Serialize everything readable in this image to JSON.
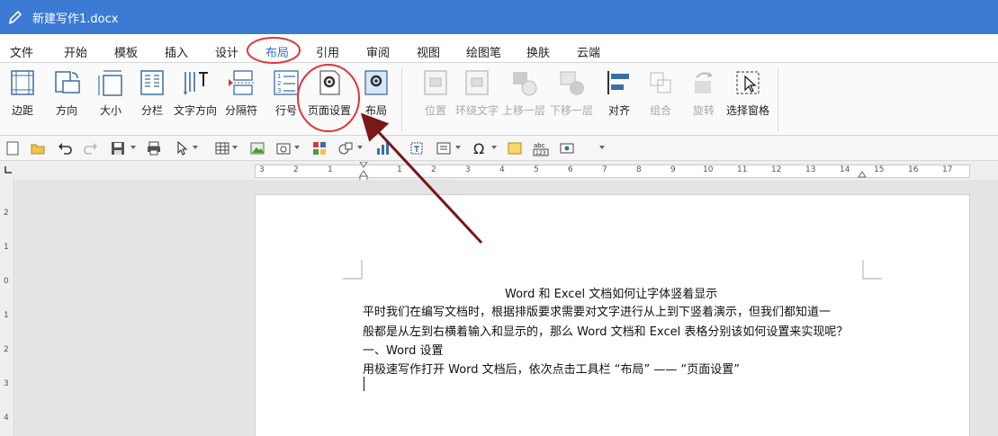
{
  "window": {
    "title": "新建写作1.docx"
  },
  "tabs": [
    {
      "label": "文件"
    },
    {
      "label": "开始"
    },
    {
      "label": "模板"
    },
    {
      "label": "插入"
    },
    {
      "label": "设计"
    },
    {
      "label": "布局"
    },
    {
      "label": "引用"
    },
    {
      "label": "审阅"
    },
    {
      "label": "视图"
    },
    {
      "label": "绘图笔"
    },
    {
      "label": "换肤"
    },
    {
      "label": "云端"
    }
  ],
  "active_tab": "布局",
  "ribbon": {
    "margins": "边距",
    "orientation": "方向",
    "size": "大小",
    "columns": "分栏",
    "text_direction": "文字方向",
    "breaks": "分隔符",
    "line_numbers": "行号",
    "page_setup": "页面设置",
    "layout": "布局",
    "position": "位置",
    "wrap_text": "环绕文字",
    "bring_forward": "上移一层",
    "send_backward": "下移一层",
    "align": "对齐",
    "group": "组合",
    "rotate": "旋转",
    "selection_pane": "选择窗格"
  },
  "ruler": {
    "h_ticks": [
      "3",
      "2",
      "1",
      "1",
      "2",
      "3",
      "4",
      "5",
      "6",
      "7",
      "8",
      "9",
      "10",
      "11",
      "12",
      "13",
      "14",
      "15",
      "16",
      "17"
    ],
    "v_ticks": [
      "2",
      "1",
      "0",
      "1",
      "2",
      "3",
      "4"
    ]
  },
  "document": {
    "title": "Word 和 Excel 文档如何让字体竖着显示",
    "lines": [
      "平时我们在编写文档时，根据排版要求需要对文字进行从上到下竖着演示，但我们都知道一",
      "般都是从左到右横着输入和显示的，那么 Word 文档和 Excel 表格分别该如何设置来实现呢？",
      "一、Word 设置",
      "用极速写作打开 Word 文档后，依次点击工具栏 “布局” —— “页面设置”"
    ]
  },
  "colors": {
    "titlebar": "#3c7bd4",
    "active_tab": "#2a6fd6",
    "annotation": "#e0353a",
    "arrow": "#7a1717"
  }
}
